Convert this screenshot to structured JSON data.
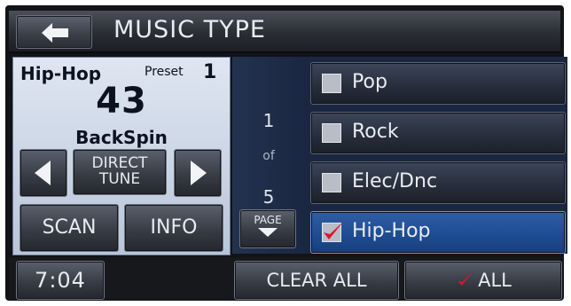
{
  "header": {
    "title": "MUSIC TYPE",
    "back_icon": "left-arrow-icon"
  },
  "now_playing": {
    "genre": "Hip-Hop",
    "preset_label": "Preset",
    "preset_number": "1",
    "channel": "43",
    "station": "BackSpin"
  },
  "controls": {
    "prev_icon": "triangle-left-icon",
    "next_icon": "triangle-right-icon",
    "direct_tune_line1": "DIRECT",
    "direct_tune_line2": "TUNE",
    "scan": "SCAN",
    "info": "INFO"
  },
  "pager": {
    "current": "1",
    "of": "of",
    "total": "5",
    "page_label": "PAGE"
  },
  "music_types": [
    {
      "label": "Pop",
      "checked": false
    },
    {
      "label": "Rock",
      "checked": false
    },
    {
      "label": "Elec/Dnc",
      "checked": false
    },
    {
      "label": "Hip-Hop",
      "checked": true
    }
  ],
  "bottom": {
    "clock": "7:04",
    "clear_all": "CLEAR ALL",
    "all": "ALL"
  },
  "colors": {
    "selected_item": "#1e4b90",
    "checkmark": "#e0162b",
    "panel": "#c7d3e6",
    "list_bg": "#1b2740"
  }
}
